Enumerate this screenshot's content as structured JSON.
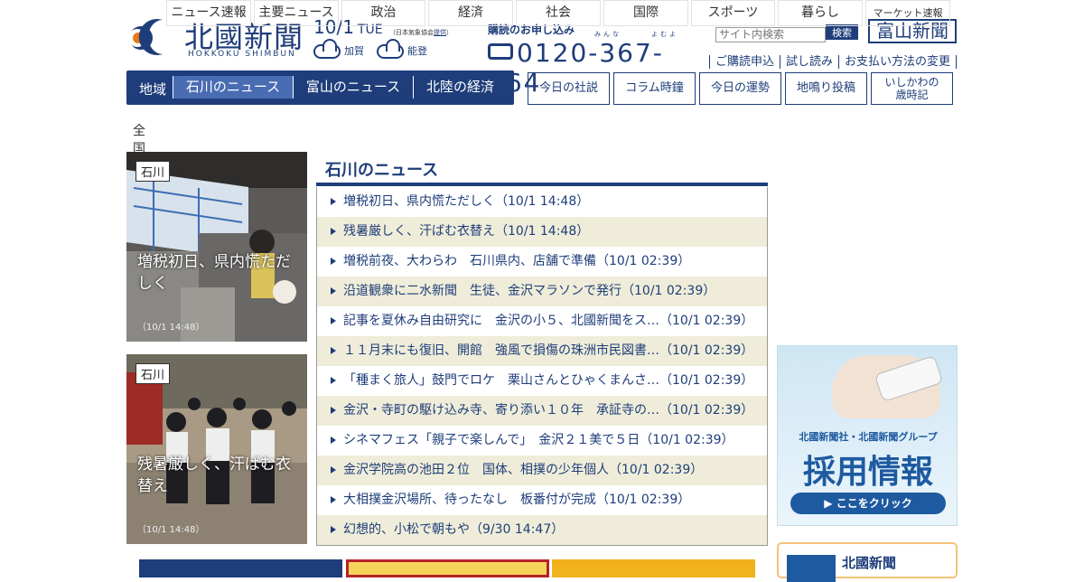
{
  "header": {
    "logo_title": "北國新聞",
    "logo_sub": "HOKKOKU SHIMBUN",
    "date": "10/1",
    "dow": "TUE",
    "weather_source": "（日本気象協会",
    "weather_source_link": "提供",
    "weather_source_end": "）",
    "weather": [
      {
        "area": "加賀",
        "icon": "cloud-icon"
      },
      {
        "area": "能登",
        "icon": "cloud-icon"
      }
    ],
    "subscribe_label": "購読のお申し込み",
    "ruby_1": "みんな",
    "ruby_2": "よむよ",
    "phone": "0120-367-464",
    "search_placeholder": "サイト内検索",
    "search_button": "検索",
    "toyama_link": "富山新聞",
    "links": [
      "ご購読申込",
      "試し読み",
      "お支払い方法の変更"
    ]
  },
  "region_nav": {
    "area_label": "地域",
    "tabs": [
      "石川のニュース",
      "富山のニュース",
      "北陸の経済"
    ],
    "active_index": 0
  },
  "box_buttons": [
    "今日の社説",
    "コラム時鐘",
    "今日の運勢",
    "地鳴り投稿",
    "いしかわの\n歳時記"
  ],
  "category_nav": {
    "all_label": "全国",
    "items": [
      "ニュース速報",
      "主要ニュース",
      "政治",
      "経済",
      "社会",
      "国際",
      "スポーツ",
      "暮らし",
      "マーケット速報"
    ]
  },
  "photos": [
    {
      "tag": "石川",
      "caption": "増税初日、県内慌ただしく",
      "time": "（10/1 14:48）"
    },
    {
      "tag": "石川",
      "caption": "残暑厳しく、汗ばむ衣替え",
      "time": "（10/1 14:48）"
    }
  ],
  "news": {
    "heading": "石川のニュース",
    "items": [
      "増税初日、県内慌ただしく（10/1 14:48）",
      "残暑厳しく、汗ばむ衣替え（10/1 14:48）",
      "増税前夜、大わらわ　石川県内、店舗で準備（10/1 02:39）",
      "沿道観衆に二水新聞　生徒、金沢マラソンで発行（10/1 02:39）",
      "記事を夏休み自由研究に　金沢の小５、北國新聞をス…（10/1 02:39）",
      "１１月末にも復旧、開館　強風で損傷の珠洲市民図書…（10/1 02:39）",
      "「種まく旅人」鼓門でロケ　栗山さんとひゃくまんさ…（10/1 02:39）",
      "金沢・寺町の駆け込み寺、寄り添い１０年　承証寺の…（10/1 02:39）",
      "シネマフェス「親子で楽しんで」　金沢２１美で５日（10/1 02:39）",
      "金沢学院高の池田２位　国体、相撲の少年個人（10/1 02:39）",
      "大相撲金沢場所、待ったなし　板番付が完成（10/1 02:39）",
      "幻想的、小松で朝もや（9/30 14:47）"
    ]
  },
  "recruit_ad": {
    "group": "北國新聞社・北國新聞グループ",
    "title": "採用情報",
    "button": "▶ ここをクリック"
  },
  "hokkoku_box": {
    "title": "北國新聞"
  },
  "colors": {
    "brand": "#1e3d7a",
    "active_tab": "#4a6cb3",
    "row_stripe": "#efedd9",
    "recruit_blue": "#1e5aa0"
  }
}
